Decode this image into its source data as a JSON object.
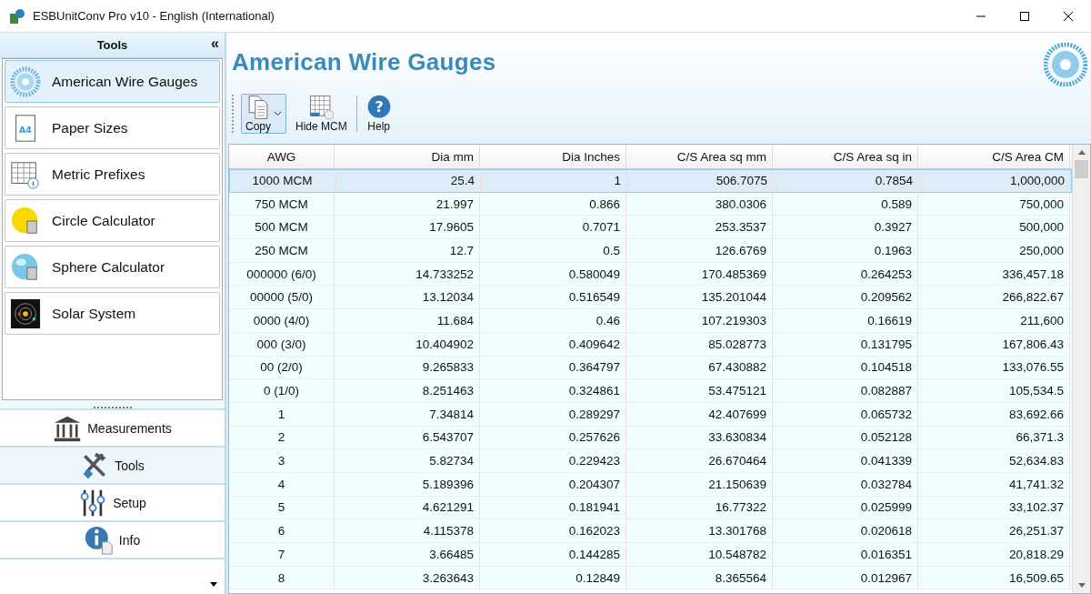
{
  "window": {
    "title": "ESBUnitConv Pro v10 - English (International)"
  },
  "sidebar": {
    "title": "Tools",
    "collapse": "«",
    "items": [
      {
        "label": "American Wire Gauges",
        "selected": true
      },
      {
        "label": "Paper Sizes",
        "icon_text": "A4",
        "selected": false
      },
      {
        "label": "Metric Prefixes",
        "selected": false
      },
      {
        "label": "Circle Calculator",
        "selected": false
      },
      {
        "label": "Sphere Calculator",
        "selected": false
      },
      {
        "label": "Solar System",
        "selected": false
      }
    ],
    "nav": [
      {
        "label": "Measurements",
        "selected": false
      },
      {
        "label": "Tools",
        "selected": true
      },
      {
        "label": "Setup",
        "selected": false
      },
      {
        "label": "Info",
        "selected": false
      }
    ]
  },
  "page": {
    "title": "American Wire Gauges"
  },
  "toolbar": [
    {
      "label": "Copy",
      "dropdown": true
    },
    {
      "label": "Hide MCM",
      "dropdown": false
    },
    {
      "label": "Help",
      "icon_text": "?",
      "dropdown": false
    }
  ],
  "table": {
    "columns": [
      "AWG",
      "Dia mm",
      "Dia Inches",
      "C/S Area sq mm",
      "C/S Area sq in",
      "C/S Area CM"
    ],
    "rows": [
      {
        "selected": true,
        "cells": [
          "1000 MCM",
          "25.4",
          "1",
          "506.7075",
          "0.7854",
          "1,000,000"
        ]
      },
      {
        "selected": false,
        "cells": [
          "750 MCM",
          "21.997",
          "0.866",
          "380.0306",
          "0.589",
          "750,000"
        ]
      },
      {
        "selected": false,
        "cells": [
          "500 MCM",
          "17.9605",
          "0.7071",
          "253.3537",
          "0.3927",
          "500,000"
        ]
      },
      {
        "selected": false,
        "cells": [
          "250 MCM",
          "12.7",
          "0.5",
          "126.6769",
          "0.1963",
          "250,000"
        ]
      },
      {
        "selected": false,
        "cells": [
          "000000 (6/0)",
          "14.733252",
          "0.580049",
          "170.485369",
          "0.264253",
          "336,457.18"
        ]
      },
      {
        "selected": false,
        "cells": [
          "00000 (5/0)",
          "13.12034",
          "0.516549",
          "135.201044",
          "0.209562",
          "266,822.67"
        ]
      },
      {
        "selected": false,
        "cells": [
          "0000 (4/0)",
          "11.684",
          "0.46",
          "107.219303",
          "0.16619",
          "211,600"
        ]
      },
      {
        "selected": false,
        "cells": [
          "000 (3/0)",
          "10.404902",
          "0.409642",
          "85.028773",
          "0.131795",
          "167,806.43"
        ]
      },
      {
        "selected": false,
        "cells": [
          "00 (2/0)",
          "9.265833",
          "0.364797",
          "67.430882",
          "0.104518",
          "133,076.55"
        ]
      },
      {
        "selected": false,
        "cells": [
          "0 (1/0)",
          "8.251463",
          "0.324861",
          "53.475121",
          "0.082887",
          "105,534.5"
        ]
      },
      {
        "selected": false,
        "cells": [
          "1",
          "7.34814",
          "0.289297",
          "42.407699",
          "0.065732",
          "83,692.66"
        ]
      },
      {
        "selected": false,
        "cells": [
          "2",
          "6.543707",
          "0.257626",
          "33.630834",
          "0.052128",
          "66,371.3"
        ]
      },
      {
        "selected": false,
        "cells": [
          "3",
          "5.82734",
          "0.229423",
          "26.670464",
          "0.041339",
          "52,634.83"
        ]
      },
      {
        "selected": false,
        "cells": [
          "4",
          "5.189396",
          "0.204307",
          "21.150639",
          "0.032784",
          "41,741.32"
        ]
      },
      {
        "selected": false,
        "cells": [
          "5",
          "4.621291",
          "0.181941",
          "16.77322",
          "0.025999",
          "33,102.37"
        ]
      },
      {
        "selected": false,
        "cells": [
          "6",
          "4.115378",
          "0.162023",
          "13.301768",
          "0.020618",
          "26,251.37"
        ]
      },
      {
        "selected": false,
        "cells": [
          "7",
          "3.66485",
          "0.144285",
          "10.548782",
          "0.016351",
          "20,818.29"
        ]
      },
      {
        "selected": false,
        "cells": [
          "8",
          "3.263643",
          "0.12849",
          "8.365564",
          "0.012967",
          "16,509.65"
        ]
      }
    ]
  }
}
